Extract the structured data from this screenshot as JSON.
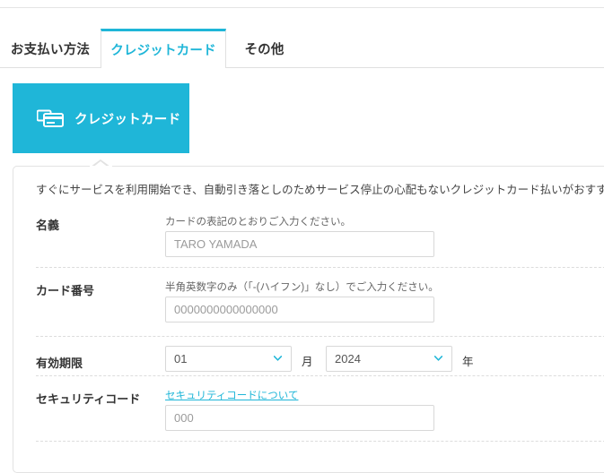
{
  "tabs": [
    {
      "label": "お支払い方法",
      "active": false,
      "name": "tab-payment-method"
    },
    {
      "label": "クレジットカード",
      "active": true,
      "name": "tab-credit-card"
    },
    {
      "label": "その他",
      "active": false,
      "name": "tab-other"
    }
  ],
  "card_header": {
    "title": "クレジットカード",
    "icon": "credit-card-icon",
    "background_color": "#1fb6d8"
  },
  "form": {
    "lead_text": "すぐにサービスを利用開始でき、自動引き落としのためサービス停止の心配もないクレジットカード払いがおすすめです。",
    "name_row": {
      "label": "名義",
      "hint": "カードの表記のとおりご入力ください。",
      "placeholder": "TARO YAMADA",
      "value": ""
    },
    "number_row": {
      "label": "カード番号",
      "hint": "半角英数字のみ（「-(ハイフン)」なし）でご入力ください。",
      "placeholder": "0000000000000000",
      "value": ""
    },
    "expiry_row": {
      "label": "有効期限",
      "month_value": "01",
      "month_unit": "月",
      "year_value": "2024",
      "year_unit": "年"
    },
    "security_row": {
      "label": "セキュリティコード",
      "link_text": "セキュリティコードについて",
      "placeholder": "000",
      "value": ""
    }
  },
  "colors": {
    "accent": "#1fb6d8",
    "text": "#333333",
    "hint": "#666666",
    "border": "#e2e2e2",
    "placeholder": "#9b9b9b"
  }
}
